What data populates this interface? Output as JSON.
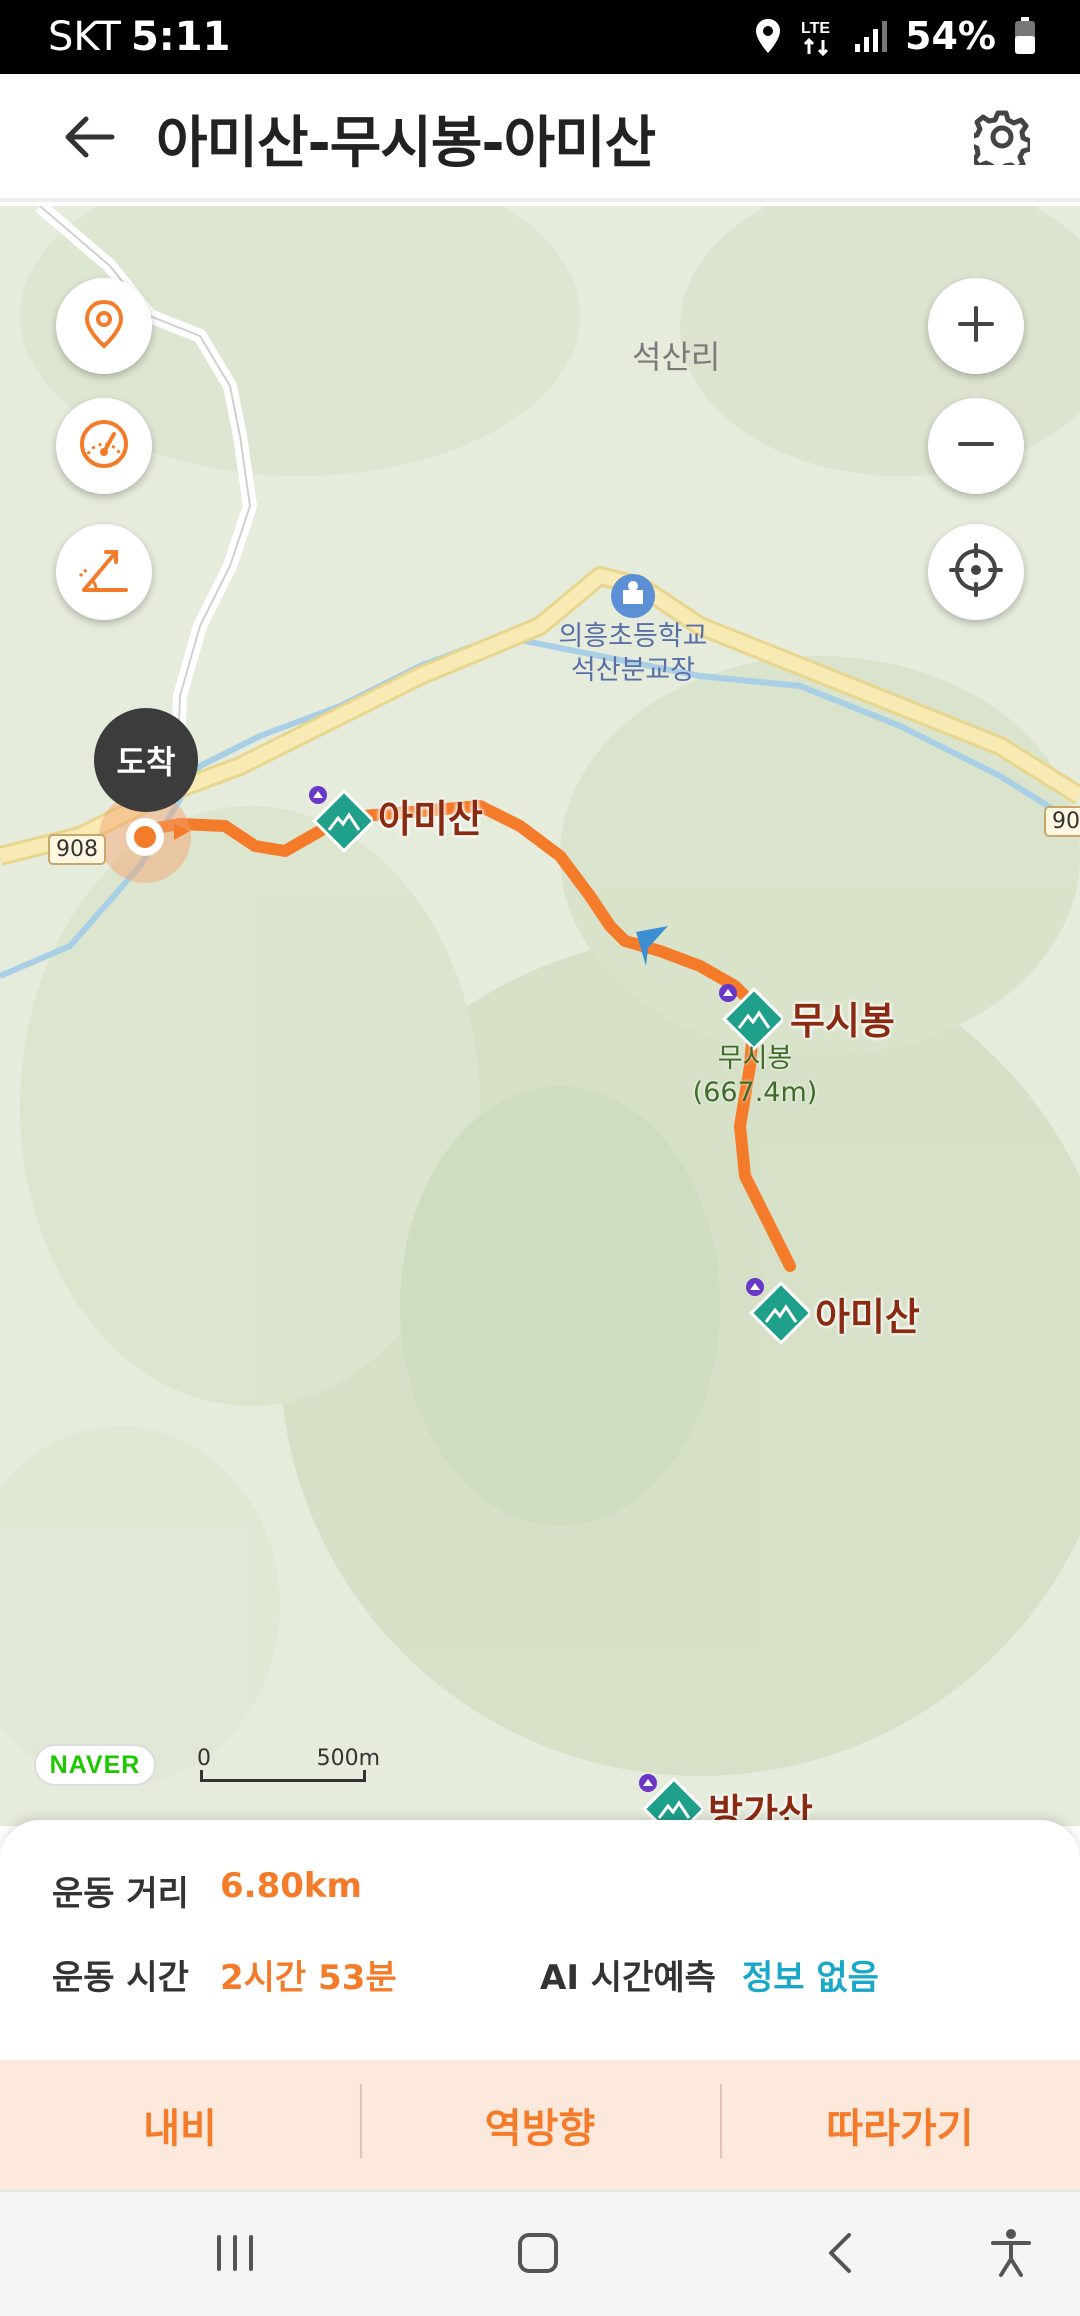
{
  "status_bar": {
    "carrier": "SKT",
    "time": "5:11",
    "network": "LTE",
    "battery": "54%",
    "icons": [
      "location-icon",
      "lte-icon",
      "signal-icon",
      "battery-icon"
    ]
  },
  "header": {
    "title": "아미산-무시봉-아미산",
    "back_icon": "back-arrow-icon",
    "settings_icon": "gear-icon"
  },
  "map": {
    "place_labels": {
      "village": "석산리",
      "school_line1": "의흥초등학교",
      "school_line2": "석산분교장"
    },
    "road_numbers": [
      "908",
      "90"
    ],
    "arrive_badge": "도착",
    "peaks": [
      {
        "name": "아미산"
      },
      {
        "name": "무시봉",
        "sub1": "무시봉",
        "sub2": "(667.4m)"
      },
      {
        "name": "아미산"
      },
      {
        "name": "방가산"
      }
    ],
    "left_controls": [
      "location-pin-icon",
      "speedometer-icon",
      "slope-icon"
    ],
    "right_controls": [
      "zoom-in-icon",
      "zoom-out-icon",
      "crosshair-icon"
    ],
    "logo": "NAVER",
    "scale": {
      "start": "0",
      "end": "500m"
    },
    "colors": {
      "route": "#f47b2a",
      "peak_marker": "#1fa08a",
      "road": "#f6e6a8"
    }
  },
  "sheet": {
    "distance_label": "운동 거리",
    "distance_value": "6.80km",
    "time_label": "운동 시간",
    "time_value": "2시간 53분",
    "ai_label": "AI 시간예측",
    "ai_value": "정보 없음",
    "colors": {
      "accent": "#f47b2a",
      "info": "#1aa8c9"
    }
  },
  "actions": [
    "내비",
    "역방향",
    "따라가기"
  ],
  "nav_bar": [
    "recent-apps-icon",
    "home-icon",
    "back-icon",
    "accessibility-icon"
  ]
}
